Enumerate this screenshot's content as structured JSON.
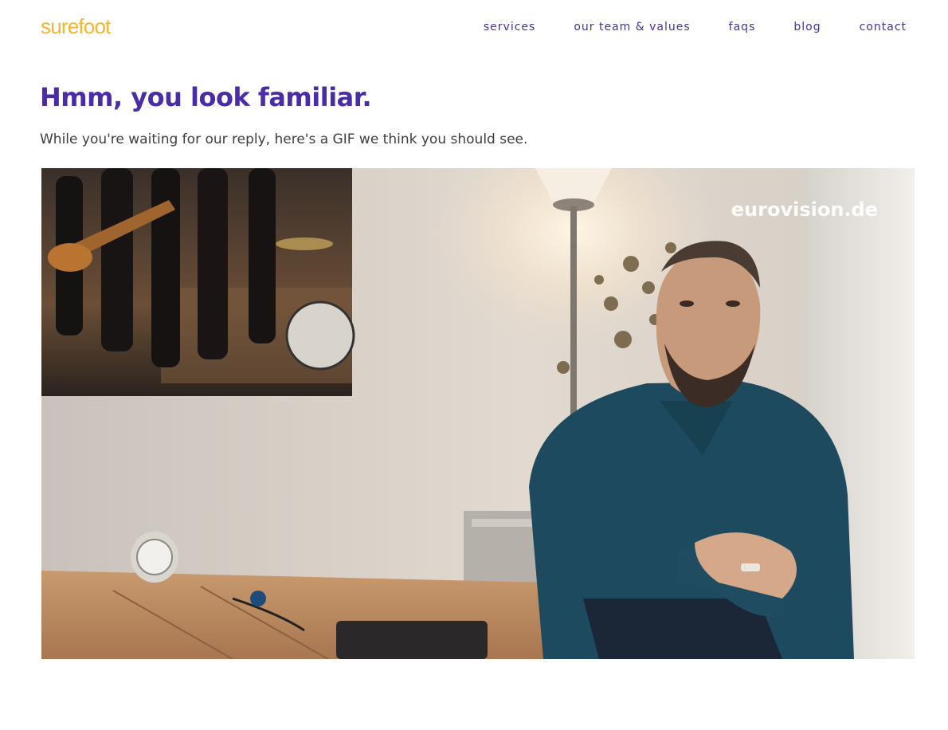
{
  "header": {
    "logo": "surefoot",
    "nav": [
      {
        "label": "services"
      },
      {
        "label": "our team & values"
      },
      {
        "label": "faqs"
      },
      {
        "label": "blog"
      },
      {
        "label": "contact"
      }
    ]
  },
  "main": {
    "title": "Hmm, you look familiar.",
    "subtitle": "While you're waiting for our reply, here's a GIF we think you should see.",
    "gif": {
      "watermark": "eurovision.de",
      "subject": "man-on-couch-gesture"
    }
  },
  "colors": {
    "logo": "#f6b52b",
    "nav": "#4a2f9a",
    "headline": "#4a2ca7",
    "body_text": "#3e3e3e"
  }
}
